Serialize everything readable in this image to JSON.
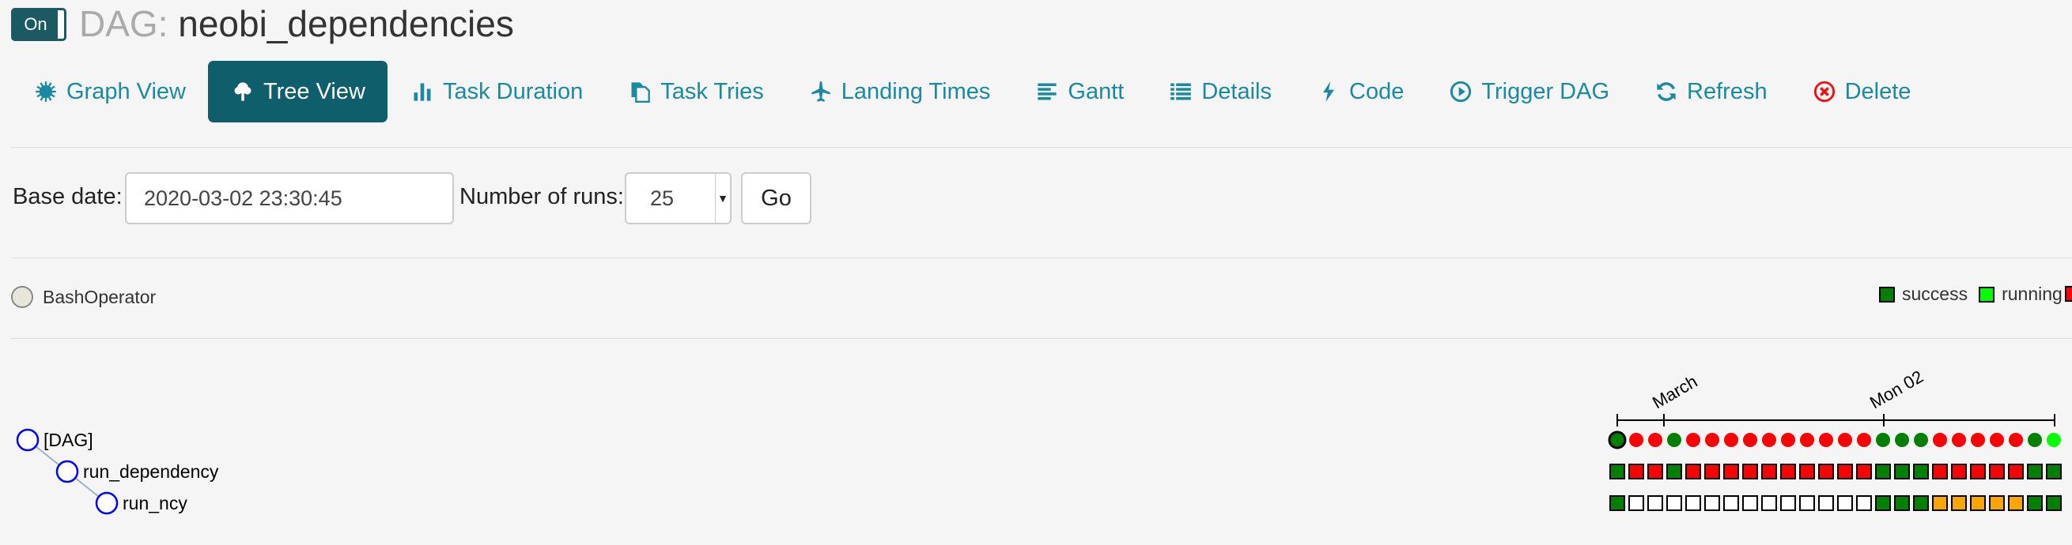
{
  "header": {
    "toggle_label": "On",
    "title_prefix": "DAG:",
    "dag_id": "neobi_dependencies"
  },
  "nav": [
    {
      "label": "Graph View",
      "icon": "gear-icon",
      "active": false
    },
    {
      "label": "Tree View",
      "icon": "tree-icon",
      "active": true
    },
    {
      "label": "Task Duration",
      "icon": "bar-chart-icon",
      "active": false
    },
    {
      "label": "Task Tries",
      "icon": "duplicate-icon",
      "active": false
    },
    {
      "label": "Landing Times",
      "icon": "plane-icon",
      "active": false
    },
    {
      "label": "Gantt",
      "icon": "align-left-icon",
      "active": false
    },
    {
      "label": "Details",
      "icon": "list-icon",
      "active": false
    },
    {
      "label": "Code",
      "icon": "flash-icon",
      "active": false
    },
    {
      "label": "Trigger DAG",
      "icon": "play-circle-icon",
      "active": false
    },
    {
      "label": "Refresh",
      "icon": "refresh-icon",
      "active": false
    },
    {
      "label": "Delete",
      "icon": "remove-circle-icon",
      "active": false
    }
  ],
  "form": {
    "base_date_label": "Base date:",
    "base_date_value": "2020-03-02 23:30:45",
    "runs_label": "Number of runs:",
    "runs_value": "25",
    "go_label": "Go"
  },
  "legend": {
    "operator": "BashOperator",
    "states": [
      {
        "label": "success",
        "color": "#008000"
      },
      {
        "label": "running",
        "color": "#00ff00"
      }
    ],
    "cut_off_color": "#ff0000"
  },
  "colors": {
    "success": "#008000",
    "running": "#00ff00",
    "failed": "#ff0000",
    "upstream_failed": "#ffa500",
    "none": "#ffffff",
    "link": "#1a8aa0",
    "brand": "#0f5e6b",
    "tree_node": "#0000ff"
  },
  "tree": {
    "nodes": [
      {
        "label": "[DAG]",
        "depth": 0
      },
      {
        "label": "run_dependency",
        "depth": 1
      },
      {
        "label": "run_ncy",
        "depth": 2
      }
    ],
    "axis_labels": [
      "March",
      "Mon 02"
    ]
  },
  "grid": {
    "dag_runs": [
      "success",
      "failed",
      "failed",
      "success",
      "failed",
      "failed",
      "failed",
      "failed",
      "failed",
      "failed",
      "failed",
      "failed",
      "failed",
      "failed",
      "success",
      "success",
      "success",
      "failed",
      "failed",
      "failed",
      "failed",
      "failed",
      "success",
      "running"
    ],
    "run_dependency": [
      "success",
      "failed",
      "failed",
      "success",
      "failed",
      "failed",
      "failed",
      "failed",
      "failed",
      "failed",
      "failed",
      "failed",
      "failed",
      "failed",
      "success",
      "success",
      "success",
      "failed",
      "failed",
      "failed",
      "failed",
      "failed",
      "success",
      "success"
    ],
    "run_ncy": [
      "success",
      "none",
      "none",
      "none",
      "none",
      "none",
      "none",
      "none",
      "none",
      "none",
      "none",
      "none",
      "none",
      "none",
      "success",
      "success",
      "success",
      "upstream_failed",
      "upstream_failed",
      "upstream_failed",
      "upstream_failed",
      "upstream_failed",
      "success",
      "success"
    ]
  }
}
